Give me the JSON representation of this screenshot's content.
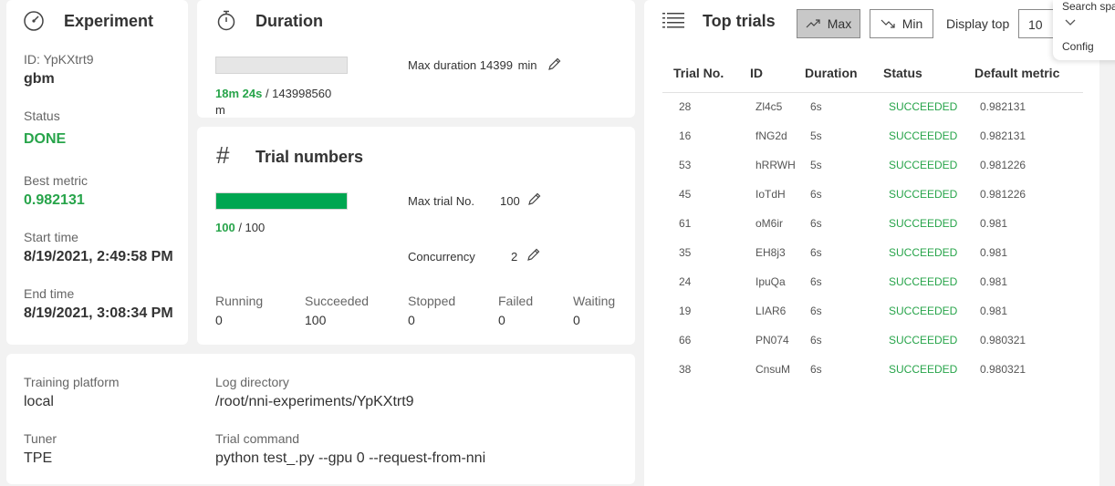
{
  "experiment": {
    "title": "Experiment",
    "id_label": "ID: YpKXtrt9",
    "name": "gbm",
    "status_label": "Status",
    "status_value": "DONE",
    "best_metric_label": "Best metric",
    "best_metric_value": "0.982131",
    "start_label": "Start time",
    "start_value": "8/19/2021, 2:49:58 PM",
    "end_label": "End time",
    "end_value": "8/19/2021, 3:08:34 PM"
  },
  "duration": {
    "title": "Duration",
    "progress_fraction": 0.0,
    "elapsed": "18m 24s",
    "separator": " / ",
    "total": "143998560",
    "unit": "m",
    "max_label": "Max duration",
    "max_value": "14399",
    "max_unit": "min"
  },
  "trials": {
    "title": "Trial numbers",
    "progress_fraction": 1.0,
    "done": "100",
    "separator": " / ",
    "total": "100",
    "max_label": "Max trial No.",
    "max_value": "100",
    "concurrency_label": "Concurrency",
    "concurrency_value": "2",
    "stats": [
      {
        "label": "Running",
        "value": "0"
      },
      {
        "label": "Succeeded",
        "value": "100"
      },
      {
        "label": "Stopped",
        "value": "0"
      },
      {
        "label": "Failed",
        "value": "0"
      },
      {
        "label": "Waiting",
        "value": "0"
      }
    ]
  },
  "info": {
    "platform_label": "Training platform",
    "platform_value": "local",
    "logdir_label": "Log directory",
    "logdir_value": "/root/nni-experiments/YpKXtrt9",
    "tuner_label": "Tuner",
    "tuner_value": "TPE",
    "command_label": "Trial command",
    "command_value": "python test_.py --gpu 0 --request-from-nni"
  },
  "top_trials": {
    "title": "Top trials",
    "max_button": "Max",
    "min_button": "Min",
    "display_top_label": "Display top",
    "display_top_value": "10",
    "columns": [
      "Trial No.",
      "ID",
      "Duration",
      "Status",
      "Default metric"
    ],
    "rows": [
      [
        "28",
        "Zl4c5",
        "6s",
        "SUCCEEDED",
        "0.982131"
      ],
      [
        "16",
        "fNG2d",
        "5s",
        "SUCCEEDED",
        "0.982131"
      ],
      [
        "53",
        "hRRWH",
        "5s",
        "SUCCEEDED",
        "0.981226"
      ],
      [
        "45",
        "IoTdH",
        "6s",
        "SUCCEEDED",
        "0.981226"
      ],
      [
        "61",
        "oM6ir",
        "6s",
        "SUCCEEDED",
        "0.981"
      ],
      [
        "35",
        "EH8j3",
        "6s",
        "SUCCEEDED",
        "0.981"
      ],
      [
        "24",
        "IpuQa",
        "6s",
        "SUCCEEDED",
        "0.981"
      ],
      [
        "19",
        "LIAR6",
        "6s",
        "SUCCEEDED",
        "0.981"
      ],
      [
        "66",
        "PN074",
        "6s",
        "SUCCEEDED",
        "0.980321"
      ],
      [
        "38",
        "CnsuM",
        "6s",
        "SUCCEEDED",
        "0.980321"
      ]
    ]
  },
  "side_menu": {
    "search_label": "Search spa",
    "config_label": "Config"
  },
  "colors": {
    "accent_green": "#27a44a",
    "progress_green": "#00a651",
    "progress_track": "#e6e6e6"
  },
  "icons": [
    "speedometer-icon",
    "stopwatch-icon",
    "hash-icon",
    "list-icon",
    "pencil-icon",
    "trend-up-icon",
    "trend-down-icon",
    "chevron-down-icon"
  ]
}
